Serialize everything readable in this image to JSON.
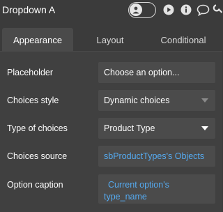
{
  "header": {
    "title": "Dropdown A",
    "icons": [
      "user-icon",
      "play-icon",
      "info-icon",
      "comment-icon",
      "wrench-icon"
    ]
  },
  "tabs": [
    {
      "label": "Appearance",
      "active": true
    },
    {
      "label": "Layout",
      "active": false
    },
    {
      "label": "Conditional",
      "active": false
    }
  ],
  "properties": {
    "placeholder": {
      "label": "Placeholder",
      "value": "Choose an option..."
    },
    "choices_style": {
      "label": "Choices style",
      "value": "Dynamic choices"
    },
    "type_of_choices": {
      "label": "Type of choices",
      "value": "Product Type"
    },
    "choices_source": {
      "label": "Choices source",
      "value": "sbProductTypes's Objects"
    },
    "option_caption": {
      "label": "Option caption",
      "value_line1": "Current option's",
      "value_line2": "type_name"
    }
  },
  "colors": {
    "background": "#3b3b3b",
    "panel": "#404040",
    "field": "#4b4b4b",
    "dynamic_text": "#55aaf0"
  }
}
